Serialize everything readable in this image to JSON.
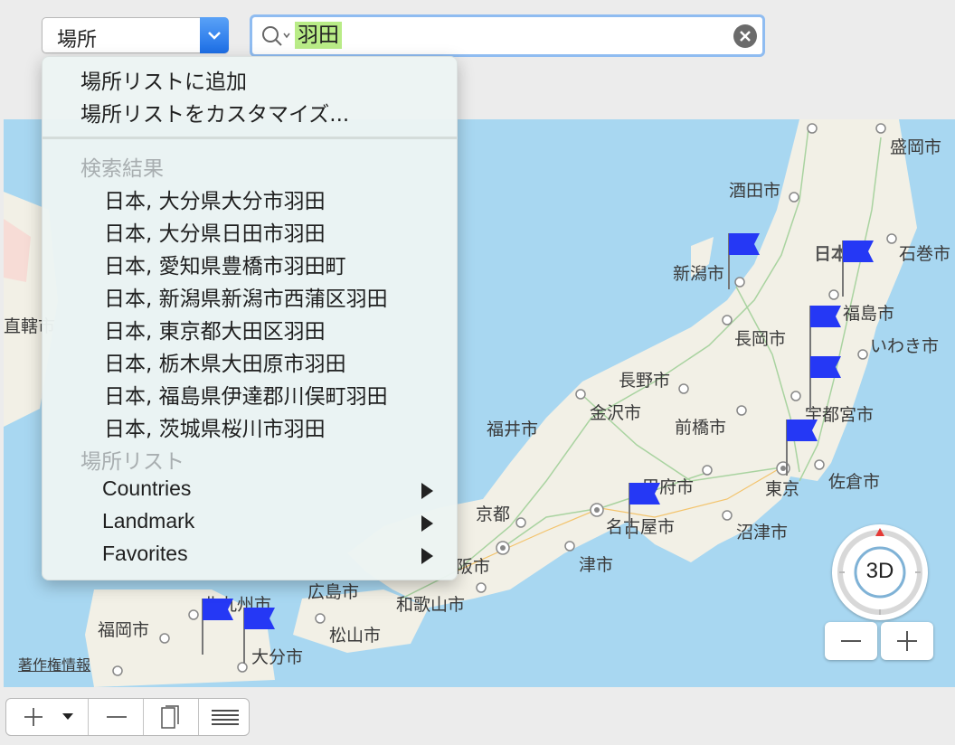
{
  "location_select": {
    "label": "場所"
  },
  "search": {
    "value": "羽田"
  },
  "menu": {
    "add_item": "場所リストに追加",
    "customize_item": "場所リストをカスタマイズ...",
    "results_header": "検索結果",
    "results": [
      "日本, 大分県大分市羽田",
      "日本, 大分県日田市羽田",
      "日本, 愛知県豊橋市羽田町",
      "日本, 新潟県新潟市西蒲区羽田",
      "日本, 東京都大田区羽田",
      "日本, 栃木県大田原市羽田",
      "日本, 福島県伊達郡川俣町羽田",
      "日本, 茨城県桜川市羽田"
    ],
    "list_header": "場所リスト",
    "lists": [
      "Countries",
      "Landmark",
      "Favorites"
    ]
  },
  "map": {
    "cities": [
      "盛岡市",
      "酒田市",
      "日本",
      "石巻市",
      "新潟市",
      "福島市",
      "長岡市",
      "いわき市",
      "長野市",
      "金沢市",
      "宇都宮市",
      "福井市",
      "前橋市",
      "甲府市",
      "佐倉市",
      "東京",
      "京都",
      "名古屋市",
      "沼津市",
      "津市",
      "阪市",
      "広島市",
      "和歌山市",
      "福岡市",
      "北九州市",
      "松山市",
      "大分市",
      "直轄市",
      "著作権情報"
    ],
    "compass_label": "3D",
    "accent_color": "#1c6ee6",
    "flag_color": "#2538f5"
  },
  "bottom_toolbar": {
    "add": "+",
    "remove": "—"
  }
}
